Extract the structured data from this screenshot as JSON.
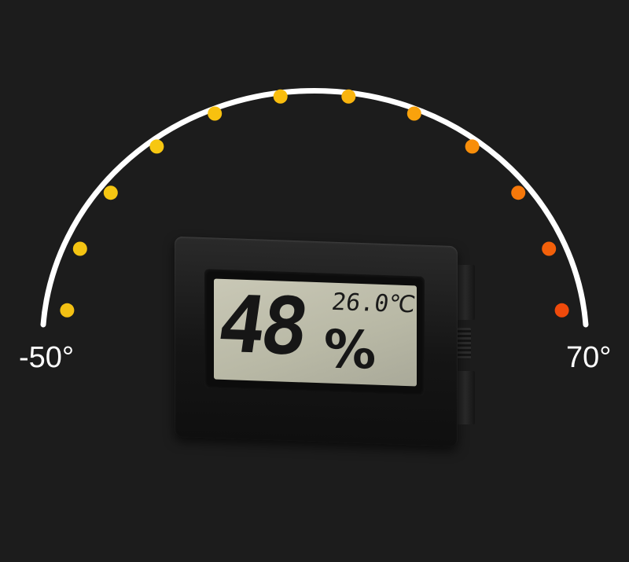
{
  "scale": {
    "min_label": "-50°",
    "max_label": "70°",
    "arc_color": "#ffffff",
    "dot_colors": [
      "#f3c013",
      "#f4c412",
      "#f5c612",
      "#f7c711",
      "#f8c10f",
      "#f9bd0e",
      "#f9b40e",
      "#f9a20c",
      "#f88e0a",
      "#f6780a",
      "#f3600a",
      "#ef4a0b"
    ]
  },
  "display": {
    "humidity": "48",
    "humidity_unit": "%",
    "temperature": "26.0℃"
  },
  "background_color": "#1c1c1c"
}
